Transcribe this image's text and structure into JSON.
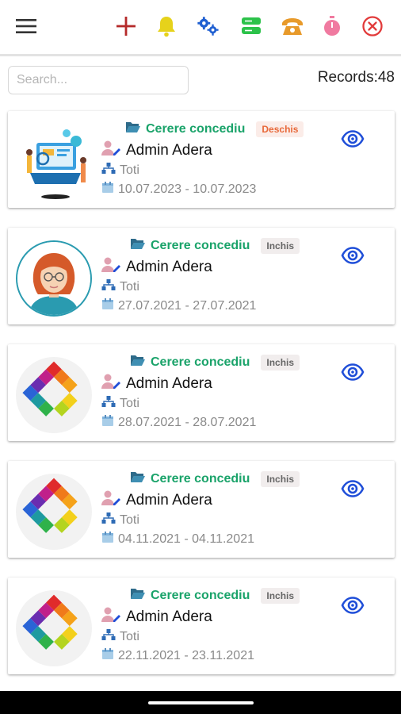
{
  "toolbar": {
    "icons": [
      "menu-icon",
      "add-icon",
      "bell-icon",
      "settings-gears-icon",
      "server-icon",
      "phone-icon",
      "stopwatch-icon",
      "close-circle-icon"
    ]
  },
  "search": {
    "placeholder": "Search...",
    "value": ""
  },
  "records": {
    "label": "Records:48"
  },
  "cards": [
    {
      "category": "Cerere concediu",
      "status": "Deschis",
      "status_color": "#e8693a",
      "name": "Admin Adera",
      "department": "Toti",
      "dates": "10.07.2023 - 10.07.2023",
      "avatar": "workspace-illustration"
    },
    {
      "category": "Cerere concediu",
      "status": "Inchis",
      "status_color": "#666666",
      "name": "Admin Adera",
      "department": "Toti",
      "dates": "27.07.2021 - 27.07.2021",
      "avatar": "woman-avatar"
    },
    {
      "category": "Cerere concediu",
      "status": "Inchis",
      "status_color": "#666666",
      "name": "Admin Adera",
      "department": "Toti",
      "dates": "28.07.2021 - 28.07.2021",
      "avatar": "adera-logo"
    },
    {
      "category": "Cerere concediu",
      "status": "Inchis",
      "status_color": "#666666",
      "name": "Admin Adera",
      "department": "Toti",
      "dates": "04.11.2021 - 04.11.2021",
      "avatar": "adera-logo"
    },
    {
      "category": "Cerere concediu",
      "status": "Inchis",
      "status_color": "#666666",
      "name": "Admin Adera",
      "department": "Toti",
      "dates": "22.11.2021 - 23.11.2021",
      "avatar": "adera-logo"
    }
  ],
  "colors": {
    "accent_green": "#1aa36a",
    "eye_blue": "#1f4ed8",
    "add_red": "#b52a2a",
    "bell_yellow": "#e6d21b",
    "gear_blue": "#1f5fd1",
    "server_green": "#2cc24a",
    "phone_orange": "#e89a2a",
    "timer_pink": "#f07aa0",
    "close_red": "#e23b3b"
  }
}
